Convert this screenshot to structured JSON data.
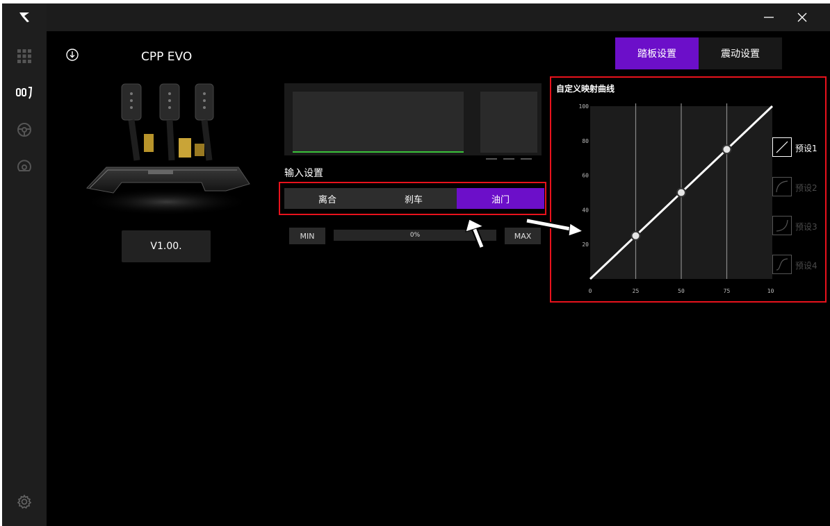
{
  "window": {
    "minimize_glyph": "—",
    "close_glyph": "✕"
  },
  "device": {
    "name": "CPP EVO",
    "version": "V1.00."
  },
  "tabs": [
    {
      "label": "踏板设置",
      "active": true
    },
    {
      "label": "震动设置",
      "active": false
    }
  ],
  "input_settings": {
    "title": "输入设置",
    "segments": [
      {
        "label": "离合",
        "active": false
      },
      {
        "label": "刹车",
        "active": false
      },
      {
        "label": "油门",
        "active": true
      }
    ],
    "min_label": "MIN",
    "max_label": "MAX",
    "range_value": "0%"
  },
  "curve": {
    "title": "自定义映射曲线",
    "presets": [
      {
        "label": "预设1",
        "active": true,
        "icon": "linear-curve-icon"
      },
      {
        "label": "预设2",
        "active": false,
        "icon": "concave-curve-icon"
      },
      {
        "label": "预设3",
        "active": false,
        "icon": "convex-curve-icon"
      },
      {
        "label": "预设4",
        "active": false,
        "icon": "s-curve-icon"
      }
    ]
  },
  "chart_data": {
    "type": "line",
    "x_ticks": [
      "0",
      "25",
      "50",
      "75",
      "100"
    ],
    "y_ticks": [
      "20",
      "40",
      "60",
      "80",
      "100"
    ],
    "xlim": [
      0,
      100
    ],
    "ylim": [
      0,
      100
    ],
    "grid": false,
    "series": [
      {
        "x": [
          0,
          100
        ],
        "y": [
          0,
          100
        ]
      }
    ],
    "handles": [
      {
        "x": 25,
        "y": 25
      },
      {
        "x": 50,
        "y": 50
      },
      {
        "x": 75,
        "y": 75
      }
    ],
    "colors": {
      "line": "#ffffff",
      "plot_bg": "#1c1c1c",
      "handle_fill": "#e6e6e6"
    }
  },
  "colors": {
    "accent": "#6c0fc9",
    "highlight": "#e8121c",
    "input_indicator": "#3ac23a"
  }
}
